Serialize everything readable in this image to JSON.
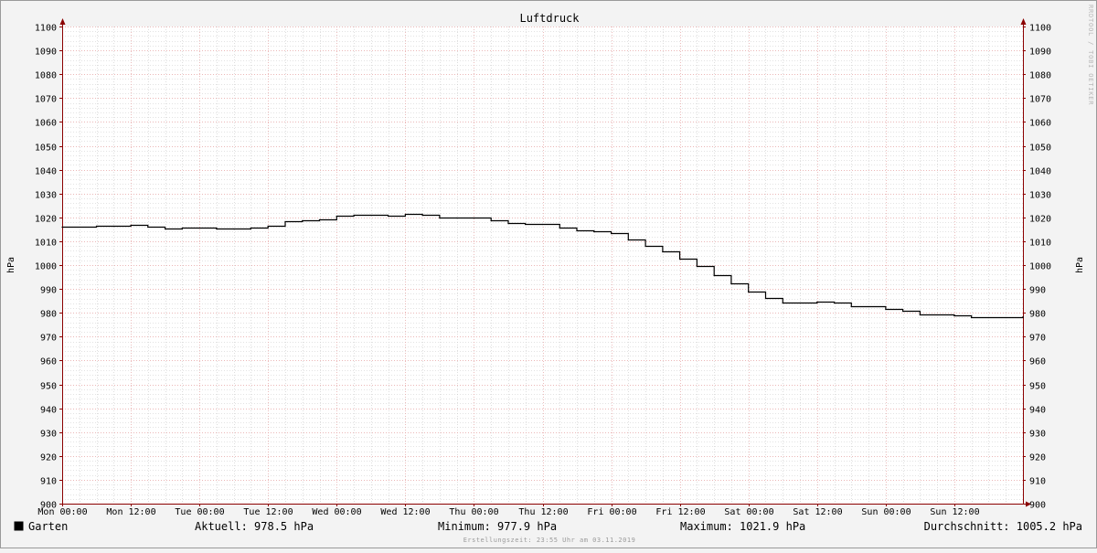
{
  "chart_data": {
    "type": "line",
    "title": "Luftdruck",
    "ylabel": "hPa",
    "xlabel": "",
    "ylim": [
      900,
      1100
    ],
    "y_ticks": [
      900,
      910,
      920,
      930,
      940,
      950,
      960,
      970,
      980,
      990,
      1000,
      1010,
      1020,
      1030,
      1040,
      1050,
      1060,
      1070,
      1080,
      1090,
      1100
    ],
    "x_ticks": [
      "Mon 00:00",
      "Mon 12:00",
      "Tue 00:00",
      "Tue 12:00",
      "Wed 00:00",
      "Wed 12:00",
      "Thu 00:00",
      "Thu 12:00",
      "Fri 00:00",
      "Fri 12:00",
      "Sat 00:00",
      "Sat 12:00",
      "Sun 00:00",
      "Sun 12:00"
    ],
    "xlim_hours": [
      0,
      168
    ],
    "grid": true,
    "series": [
      {
        "name": "Garten",
        "color": "#000000",
        "x_hours": [
          0,
          6,
          9,
          12,
          15,
          18,
          21,
          24,
          27,
          30,
          33,
          36,
          39,
          42,
          45,
          48,
          51,
          54,
          57,
          60,
          63,
          66,
          69,
          72,
          75,
          78,
          81,
          84,
          87,
          90,
          93,
          96,
          99,
          102,
          105,
          108,
          111,
          114,
          117,
          120,
          123,
          126,
          129,
          132,
          135,
          138,
          141,
          144,
          147,
          150,
          153,
          156,
          159,
          162,
          165,
          168
        ],
        "values": [
          1016.1,
          1016.3,
          1016.6,
          1017.0,
          1016.0,
          1015.4,
          1015.8,
          1015.9,
          1015.4,
          1015.3,
          1015.6,
          1016.6,
          1018.3,
          1018.6,
          1019.3,
          1020.6,
          1021.1,
          1021.0,
          1020.8,
          1021.5,
          1021.2,
          1020.0,
          1019.9,
          1019.8,
          1018.8,
          1017.8,
          1017.3,
          1017.1,
          1015.7,
          1014.6,
          1014.1,
          1013.3,
          1010.8,
          1008.2,
          1005.8,
          1002.8,
          999.5,
          995.8,
          992.4,
          989.0,
          986.1,
          984.1,
          984.2,
          984.7,
          984.1,
          982.9,
          982.7,
          981.8,
          980.9,
          979.5,
          979.3,
          978.8,
          978.3,
          978.1,
          978.3,
          978.5
        ]
      }
    ]
  },
  "legend": {
    "series_name": "Garten",
    "series_color": "#000000",
    "aktuell": "Aktuell: 978.5 hPa",
    "minimum": "Minimum: 977.9 hPa",
    "maximum": "Maximum: 1021.9 hPa",
    "durchschnitt": "Durchschnitt: 1005.2 hPa"
  },
  "footer": "Erstellungszeit: 23:55 Uhr am 03.11.2019",
  "watermark": "RRDTOOL / TOBI OETIKER",
  "colors": {
    "background": "#f3f3f3",
    "plot": "#ffffff",
    "grid_minor": "#c8c8c8",
    "grid_major": "#e5a0a0",
    "axis": "#8b0000"
  }
}
